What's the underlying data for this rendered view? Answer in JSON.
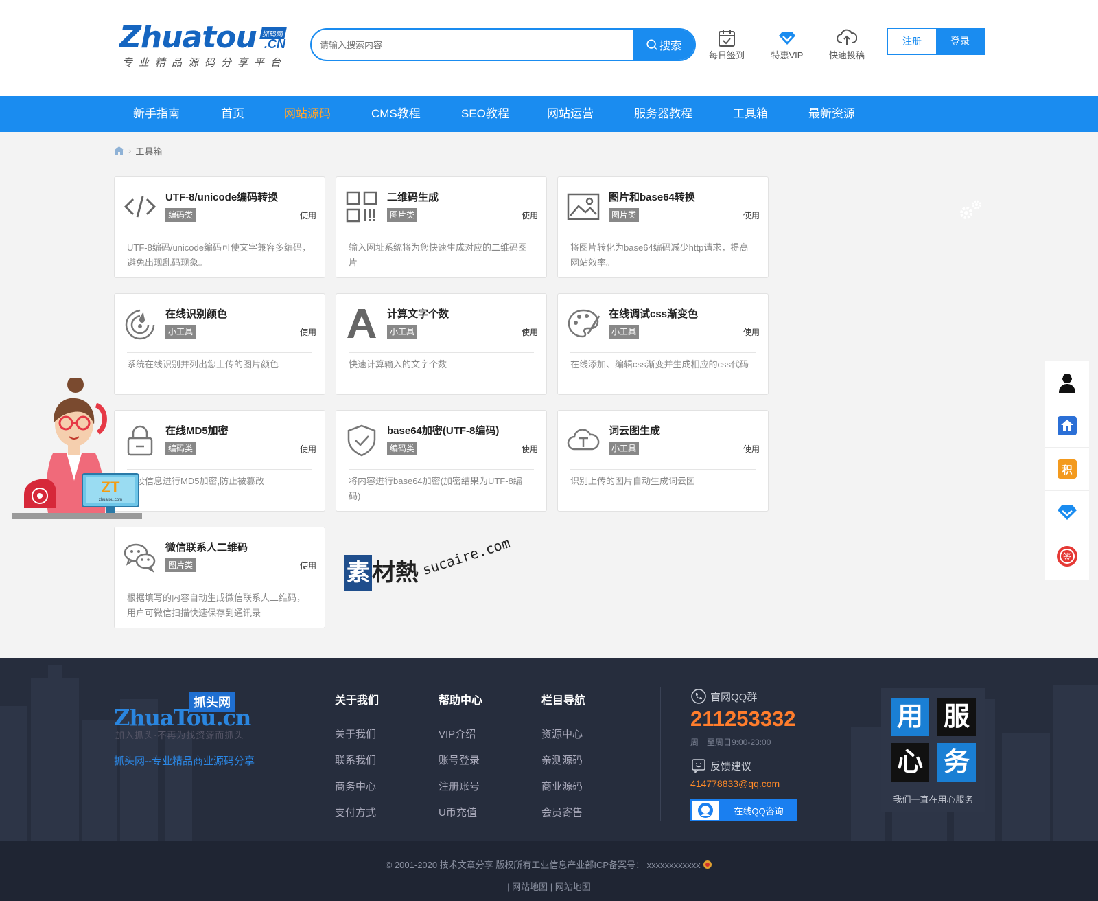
{
  "header": {
    "logo_main": "Zhuatou",
    "logo_cn": ".CN",
    "logo_badge": "抓码网",
    "logo_subtitle": "专业精品源码分享平台",
    "search_placeholder": "请输入搜索内容",
    "search_button": "搜索",
    "icons": [
      {
        "label": "每日签到",
        "icon": "calendar-check-icon"
      },
      {
        "label": "特惠VIP",
        "icon": "diamond-icon"
      },
      {
        "label": "快速投稿",
        "icon": "cloud-upload-icon"
      }
    ],
    "register_label": "注册",
    "login_label": "登录"
  },
  "nav": {
    "items": [
      "新手指南",
      "首页",
      "网站源码",
      "CMS教程",
      "SEO教程",
      "网站运营",
      "服务器教程",
      "工具箱",
      "最新资源"
    ],
    "active": "网站源码",
    "accent_color": "#1a8cf0",
    "active_color": "#ffa42d"
  },
  "breadcrumb": {
    "current": "工具箱"
  },
  "tools": [
    {
      "title": "UTF-8/unicode编码转换",
      "tag": "编码类",
      "use": "使用",
      "desc": "UTF-8编码/unicode编码可使文字兼容多编码，避免出现乱码现象。",
      "icon": "code-icon"
    },
    {
      "title": "二维码生成",
      "tag": "图片类",
      "use": "使用",
      "desc": "输入网址系统将为您快速生成对应的二维码图片",
      "icon": "qrcode-icon"
    },
    {
      "title": "图片和base64转换",
      "tag": "图片类",
      "use": "使用",
      "desc": "将图片转化为base64编码减少http请求，提高网站效率。",
      "icon": "image-icon"
    },
    {
      "title": "在线识别颜色",
      "tag": "小工具",
      "use": "使用",
      "desc": "系统在线识别并列出您上传的图片颜色",
      "icon": "color-drop-icon"
    },
    {
      "title": "计算文字个数",
      "tag": "小工具",
      "use": "使用",
      "desc": "快速计算输入的文字个数",
      "icon": "letter-a-icon"
    },
    {
      "title": "在线调试css渐变色",
      "tag": "小工具",
      "use": "使用",
      "desc": "在线添加、编辑css渐变并生成相应的css代码",
      "icon": "palette-icon"
    },
    {
      "title": "在线MD5加密",
      "tag": "编码类",
      "use": "使用",
      "desc": "一段信息进行MD5加密,防止被篡改",
      "icon": "lock-icon"
    },
    {
      "title": "base64加密(UTF-8编码)",
      "tag": "编码类",
      "use": "使用",
      "desc": "将内容进行base64加密(加密结果为UTF-8编码)",
      "icon": "shield-check-icon"
    },
    {
      "title": "词云图生成",
      "tag": "小工具",
      "use": "使用",
      "desc": "识别上传的图片自动生成词云图",
      "icon": "cloud-text-icon"
    },
    {
      "title": "微信联系人二维码",
      "tag": "图片类",
      "use": "使用",
      "desc": "根据填写的内容自动生成微信联系人二维码，用户可微信扫描快速保存到通讯录",
      "icon": "wechat-icon"
    }
  ],
  "mascot": {
    "screen_text": "ZT",
    "screen_small": "zhuatou.com"
  },
  "watermark": {
    "box": "素",
    "text": "材熱",
    "url": "sucaire.com"
  },
  "sidebar": {
    "icons": [
      "customer-service-icon",
      "home-upload-icon",
      "points-icon",
      "vip-diamond-icon",
      "sign-in-icon"
    ],
    "points_glyph": "积",
    "sign_glyph": "签"
  },
  "footer": {
    "logo_badge": "抓头网",
    "logo_main": "ZhuaTou.cn",
    "logo_sub": "加入抓头·不再为找资源而抓头",
    "slogan": "抓头网--专业精品商业源码分享",
    "columns": [
      {
        "heading": "关于我们",
        "links": [
          "关于我们",
          "联系我们",
          "商务中心",
          "支付方式"
        ]
      },
      {
        "heading": "帮助中心",
        "links": [
          "VIP介绍",
          "账号登录",
          "注册账号",
          "U币充值"
        ]
      },
      {
        "heading": "栏目导航",
        "links": [
          "资源中心",
          "亲测源码",
          "商业源码",
          "会员寄售"
        ]
      }
    ],
    "qq_group_label": "官网QQ群",
    "qq_group_number": "211253332",
    "service_hours": "周一至周日9:00-23:00",
    "feedback_label": "反馈建议",
    "feedback_email": "414778833@qq.com",
    "qq_consult_button": "在线QQ咨询",
    "service_tiles": [
      "用",
      "服",
      "心",
      "务"
    ],
    "service_caption": "我们一直在用心服务",
    "copyright": "© 2001-2020 技术文章分享 版权所有工业信息产业部ICP备案号： xxxxxxxxxxxx",
    "bottom_links": [
      "网站地图",
      "网站地图"
    ]
  }
}
